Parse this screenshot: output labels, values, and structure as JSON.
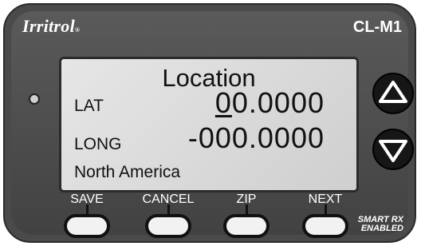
{
  "device": {
    "brand": "Irritrol",
    "brand_mark": "®",
    "model": "CL-M1",
    "badge_line1": "SMART RX",
    "badge_line2": "ENABLED"
  },
  "screen": {
    "title": "Location",
    "lat_label": "LAT",
    "lat_cursor_digit": "0",
    "lat_rest": "0.0000",
    "long_label": "LONG",
    "long_value": "-000.0000",
    "region": "North America"
  },
  "softkeys": [
    "SAVE",
    "CANCEL",
    "ZIP",
    "NEXT"
  ],
  "icons": {
    "up": "up-arrow-icon",
    "down": "down-arrow-icon"
  },
  "colors": {
    "housing": "#4a4a4a",
    "lcd": "#dcdcdc",
    "button": "#f2f2f2"
  }
}
